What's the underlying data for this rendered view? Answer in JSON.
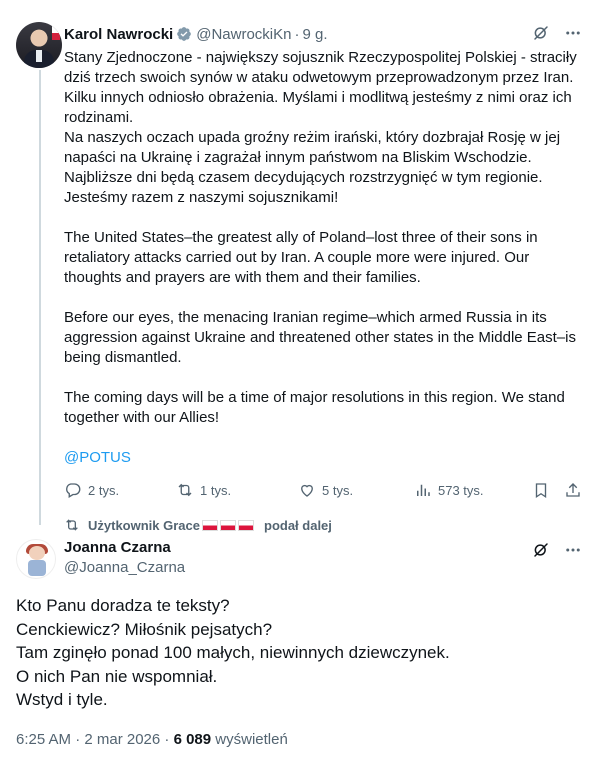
{
  "tweet1": {
    "name": "Karol Nawrocki",
    "handle": "@NawrockiKn",
    "separator": "·",
    "time": "9 g.",
    "paragraphs": [
      "Stany Zjednoczone - największy sojusznik Rzeczypospolitej Polskiej - straciły dziś trzech swoich synów w ataku odwetowym przeprowadzonym przez Iran. Kilku innych odniosło obrażenia. Myślami i modlitwą jesteśmy z nimi oraz ich rodzinami.",
      "Na naszych oczach upada groźny reżim irański, który dozbrajał Rosję w jej napaści na Ukrainę i zagrażał innym państwom na Bliskim Wschodzie. Najbliższe dni będą czasem decydujących rozstrzygnięć w tym regionie. Jesteśmy razem z naszymi sojusznikami!",
      "The United States–the greatest ally of Poland–lost three of their sons in retaliatory attacks carried out by Iran. A couple more were injured. Our thoughts and prayers are with them and their families.",
      "Before our eyes, the menacing Iranian regime–which armed Russia in its aggression against Ukraine and threatened other states in the Middle East–is being dismantled.",
      "The coming days will be a time of major resolutions in this region. We stand together with our Allies!"
    ],
    "mention": "@POTUS",
    "stats": {
      "replies": "2 tys.",
      "reposts": "1 tys.",
      "likes": "5 tys.",
      "views": "573 tys."
    }
  },
  "repost_banner": {
    "prefix": "Użytkownik Grace",
    "suffix": "podał dalej"
  },
  "tweet2": {
    "name": "Joanna Czarna",
    "handle": "@Joanna_Czarna",
    "lines": [
      "Kto Panu doradza te teksty?",
      "Cenckiewicz? Miłośnik pejsatych?",
      "Tam zginęło ponad 100 małych, niewinnych dziewczynek.",
      "O nich Pan nie wspomniał.",
      "Wstyd i tyle."
    ],
    "timestamp": "6:25 AM · 2 mar 2026 ·",
    "views_count": "6 089",
    "views_label": "wyświetleń"
  },
  "icons": {
    "reply": "reply-icon",
    "repost": "repost-icon",
    "like": "heart-icon",
    "views": "analytics-icon",
    "bookmark": "bookmark-icon",
    "share": "share-icon",
    "grok": "grok-icon",
    "more": "more-icon",
    "verified": "verified-badge-icon"
  },
  "colors": {
    "accent": "#1d9bf0",
    "muted": "#536471",
    "verified_gray": "#829aab"
  }
}
